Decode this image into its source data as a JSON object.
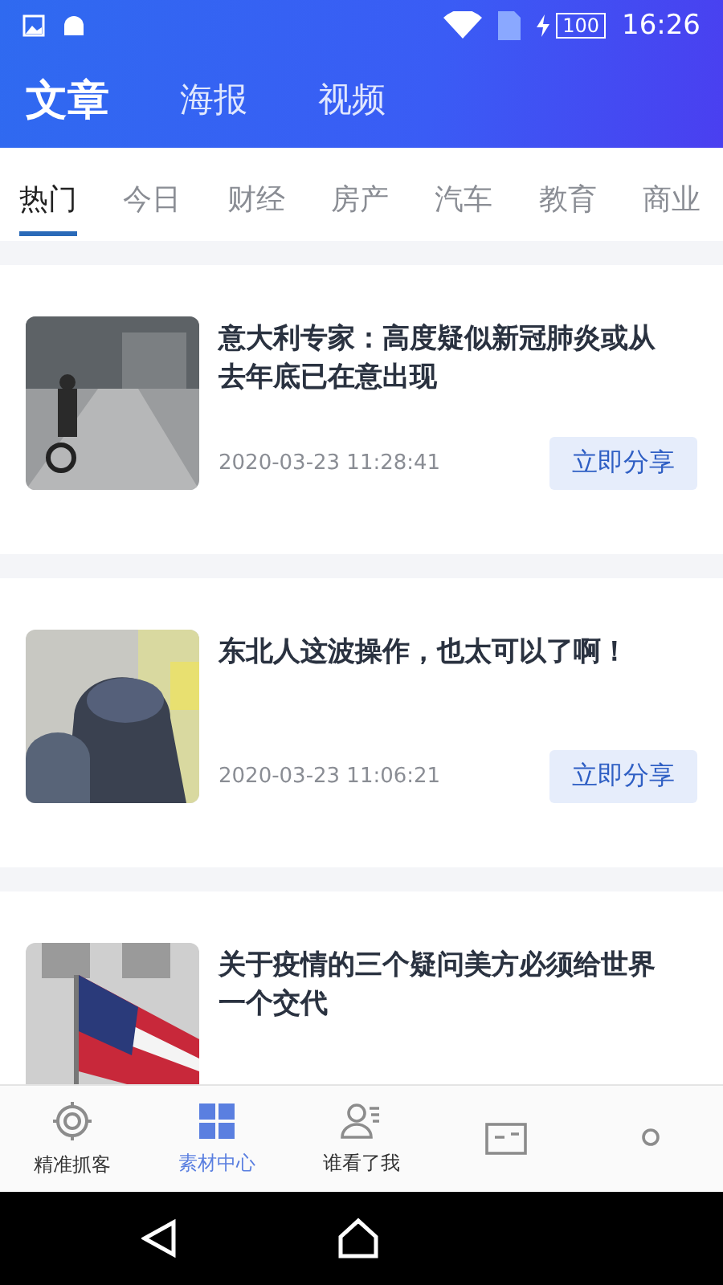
{
  "status_bar": {
    "time": "16:26",
    "battery": "100"
  },
  "header_tabs": [
    {
      "label": "文章",
      "selected": true
    },
    {
      "label": "海报",
      "selected": false
    },
    {
      "label": "视频",
      "selected": false
    }
  ],
  "category_tabs": [
    {
      "label": "热门",
      "selected": true
    },
    {
      "label": "今日",
      "selected": false
    },
    {
      "label": "财经",
      "selected": false
    },
    {
      "label": "房产",
      "selected": false
    },
    {
      "label": "汽车",
      "selected": false
    },
    {
      "label": "教育",
      "selected": false
    },
    {
      "label": "商业",
      "selected": false
    }
  ],
  "articles": [
    {
      "title": "意大利专家：高度疑似新冠肺炎或从去年底已在意出现",
      "date": "2020-03-23 11:28:41",
      "button": "立即分享"
    },
    {
      "title": "东北人这波操作，也太可以了啊！",
      "date": "2020-03-23 11:06:21",
      "button": "立即分享"
    },
    {
      "title": "关于疫情的三个疑问美方必须给世界一个交代"
    }
  ],
  "bottom_nav": [
    {
      "label": "精准抓客",
      "selected": false
    },
    {
      "label": "素材中心",
      "selected": true
    },
    {
      "label": "谁看了我",
      "selected": false
    },
    {
      "selected": false
    },
    {
      "selected": false
    }
  ]
}
